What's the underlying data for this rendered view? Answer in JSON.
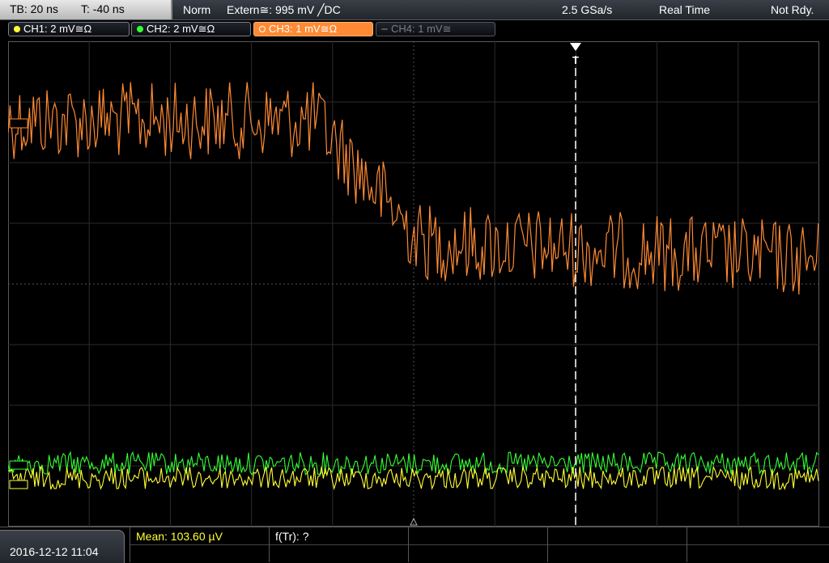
{
  "topbar": {
    "timebase": "TB: 20 ns",
    "trigger_offset": "T: -40 ns",
    "mode": "Norm",
    "trigger": "Extern≅: 995 mV ╱DC",
    "sample_rate": "2.5 GSa/s",
    "acquisition": "Real Time",
    "status": "Not Rdy."
  },
  "channels": [
    {
      "label": "CH1: 2 mV≅Ω",
      "color": "#ffff33",
      "state": "on"
    },
    {
      "label": "CH2: 2 mV≅Ω",
      "color": "#33ff33",
      "state": "on"
    },
    {
      "label": "CH3: 1 mV≅Ω",
      "color": "#ff8a33",
      "state": "active"
    },
    {
      "label": "CH4: 1 mV≅",
      "color": "#7b7f85",
      "state": "off"
    }
  ],
  "trigger_marker": "T",
  "bottombar": {
    "datetime": "2016-12-12 11:04",
    "mean": "Mean: 103.60 µV",
    "frequency": "f(Tr): ?"
  }
}
